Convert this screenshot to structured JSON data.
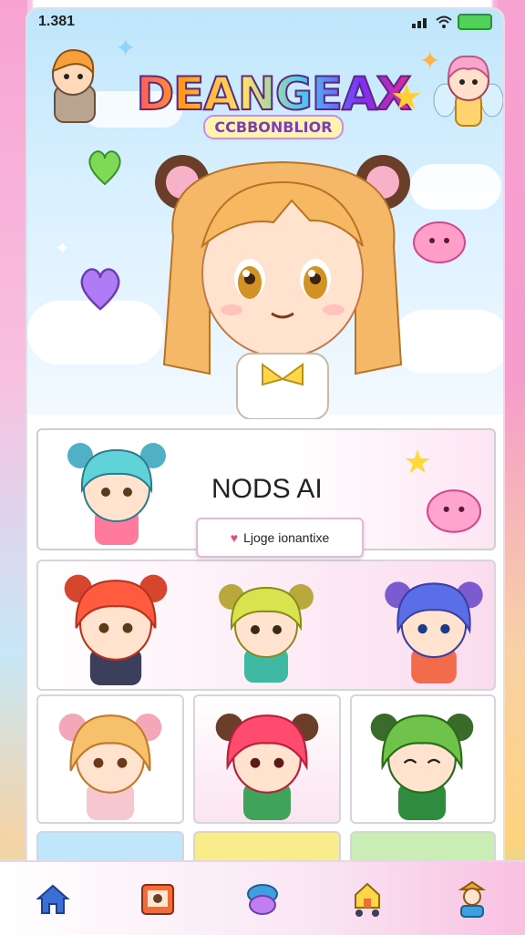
{
  "status_bar": {
    "time": "1.381",
    "signal_icon": "signal-bars-icon",
    "wifi_icon": "wifi-icon",
    "battery_icon": "battery-icon"
  },
  "header": {
    "logo_title": "DEANGEAX",
    "logo_subtitle": "CCBBONBLIOR"
  },
  "banner": {
    "title": "NODS AI",
    "pill_label": "Ljoge ionantixe"
  },
  "bottom_nav": {
    "items": [
      {
        "icon": "home-icon"
      },
      {
        "icon": "photo-frame-icon"
      },
      {
        "icon": "mascot-icon"
      },
      {
        "icon": "house-cart-icon"
      },
      {
        "icon": "profile-character-icon"
      }
    ]
  },
  "colors": {
    "accent_pink": "#f9c0e2",
    "nav_blue": "#3b6fd6",
    "sky": "#bfe6fb"
  }
}
